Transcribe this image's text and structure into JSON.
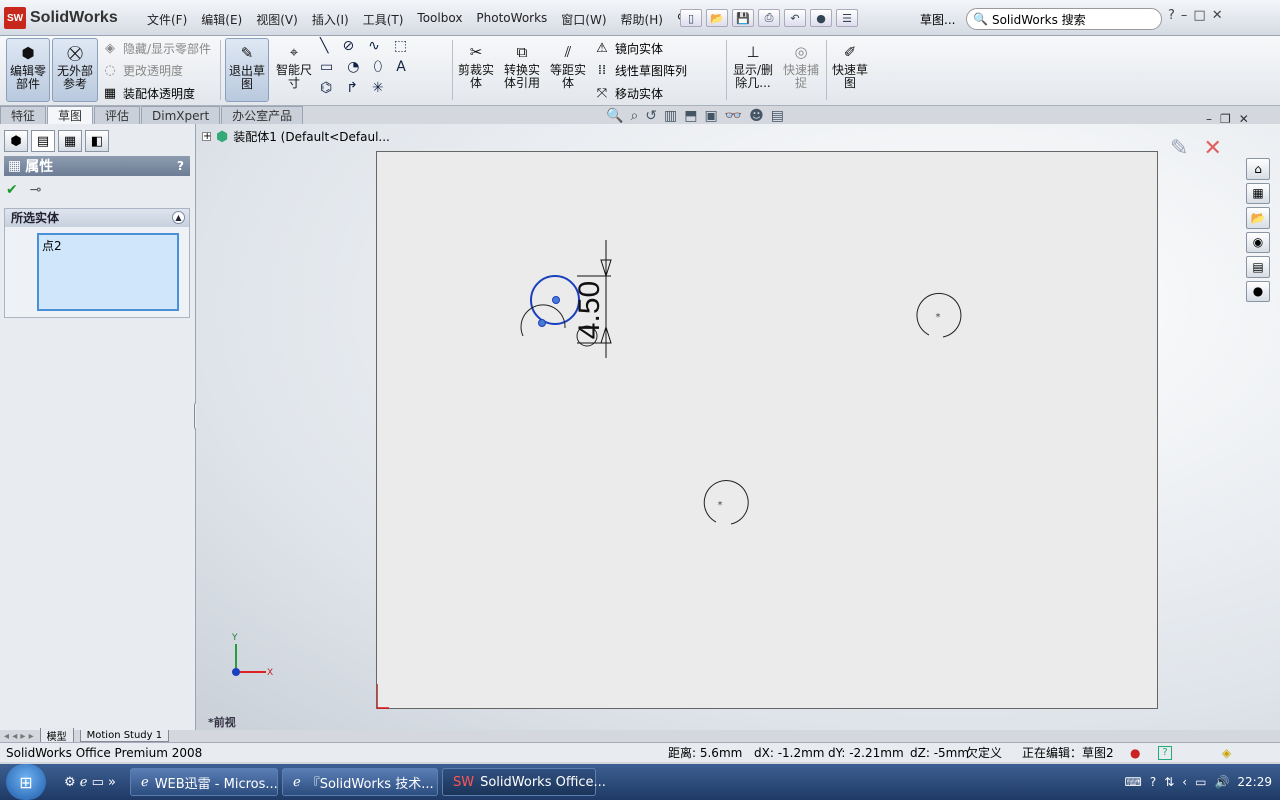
{
  "app": {
    "name": "SolidWorks",
    "logo_text": "SW"
  },
  "menu": [
    "文件(F)",
    "编辑(E)",
    "视图(V)",
    "插入(I)",
    "工具(T)",
    "Toolbox",
    "PhotoWorks",
    "窗口(W)",
    "帮助(H)"
  ],
  "quick_sketch": "草图...",
  "search": {
    "placeholder": "SolidWorks 搜索"
  },
  "commands": {
    "edit_part": "编辑零部件",
    "no_external_ref": "无外部参考",
    "hide_show": "隐藏/显示零部件",
    "change_transparency": "更改透明度",
    "assembly_transparency": "装配体透明度",
    "exit_sketch": "退出草图",
    "smart_dim": "智能尺寸",
    "trim": "剪裁实体",
    "convert": "转换实体引用",
    "offset": "等距实体",
    "mirror": "镜向实体",
    "linear_pattern": "线性草图阵列",
    "move": "移动实体",
    "show_delete": "显示/删除几...",
    "quick_snaps": "快速捕捉",
    "rapid_sketch": "快速草图"
  },
  "tabs": [
    "特征",
    "草图",
    "评估",
    "DimXpert",
    "办公室产品"
  ],
  "active_tab": "草图",
  "panel": {
    "title": "属性",
    "help": "?",
    "section": "所选实体",
    "items": [
      "点2"
    ]
  },
  "tree": {
    "root": "装配体1  (Default<Defaul..."
  },
  "sketch": {
    "dimension_text": "4.50"
  },
  "triad": {
    "y": "Y",
    "x": "X"
  },
  "orientation": "*前视",
  "model_tabs": [
    "模型",
    "Motion Study 1"
  ],
  "status": {
    "product": "SolidWorks Office Premium 2008",
    "distance": "距离: 5.6mm",
    "dx": "dX: -1.2mm",
    "dy": "dY: -2.21mm",
    "dz": "dZ: -5mm",
    "defined": "欠定义",
    "editing": "正在编辑：草图2"
  },
  "taskbar": {
    "items": [
      "WEB迅雷 - Micros...",
      "『SolidWorks 技术...",
      "SolidWorks Office..."
    ],
    "clock": "22:29"
  },
  "colors": {
    "accent": "#1a3fbf",
    "sketch_line": "#111111",
    "selection": "#cfe6fb"
  }
}
